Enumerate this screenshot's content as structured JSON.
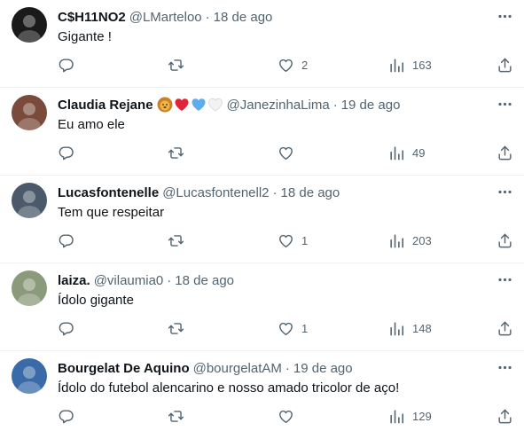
{
  "tweets": [
    {
      "name": "C$H11NO2",
      "handle": "@LMarteloo",
      "separator": "·",
      "date": "18 de ago",
      "text": "Gigante !",
      "replies": "",
      "retweets": "",
      "likes": "2",
      "views": "163",
      "avatar_color": "#1a1a1a",
      "emojis": []
    },
    {
      "name": "Claudia Rejane",
      "handle": "@JanezinhaLima",
      "separator": "·",
      "date": "19 de ago",
      "text": "Eu amo ele",
      "replies": "",
      "retweets": "",
      "likes": "",
      "views": "49",
      "avatar_color": "#7a4a3a",
      "emojis": [
        "lion-emoji",
        "red-heart-emoji",
        "blue-heart-emoji",
        "white-heart-emoji"
      ]
    },
    {
      "name": "Lucasfontenelle",
      "handle": "@Lucasfontenell2",
      "separator": "·",
      "date": "18 de ago",
      "text": "Tem que respeitar",
      "replies": "",
      "retweets": "",
      "likes": "1",
      "views": "203",
      "avatar_color": "#4a5a6a",
      "emojis": []
    },
    {
      "name": "laiza.",
      "handle": "@vilaumia0",
      "separator": "·",
      "date": "18 de ago",
      "text": "Ídolo gigante",
      "replies": "",
      "retweets": "",
      "likes": "1",
      "views": "148",
      "avatar_color": "#8a9a7a",
      "emojis": []
    },
    {
      "name": "Bourgelat De Aquino",
      "handle": "@bourgelatAM",
      "separator": "·",
      "date": "19 de ago",
      "text": "Ídolo do futebol alencarino e nosso amado tricolor de aço!",
      "replies": "",
      "retweets": "",
      "likes": "",
      "views": "129",
      "avatar_color": "#3a6aa8",
      "emojis": []
    }
  ],
  "colors": {
    "text": "#0f1419",
    "muted": "#536471",
    "divider": "#eff3f4"
  }
}
